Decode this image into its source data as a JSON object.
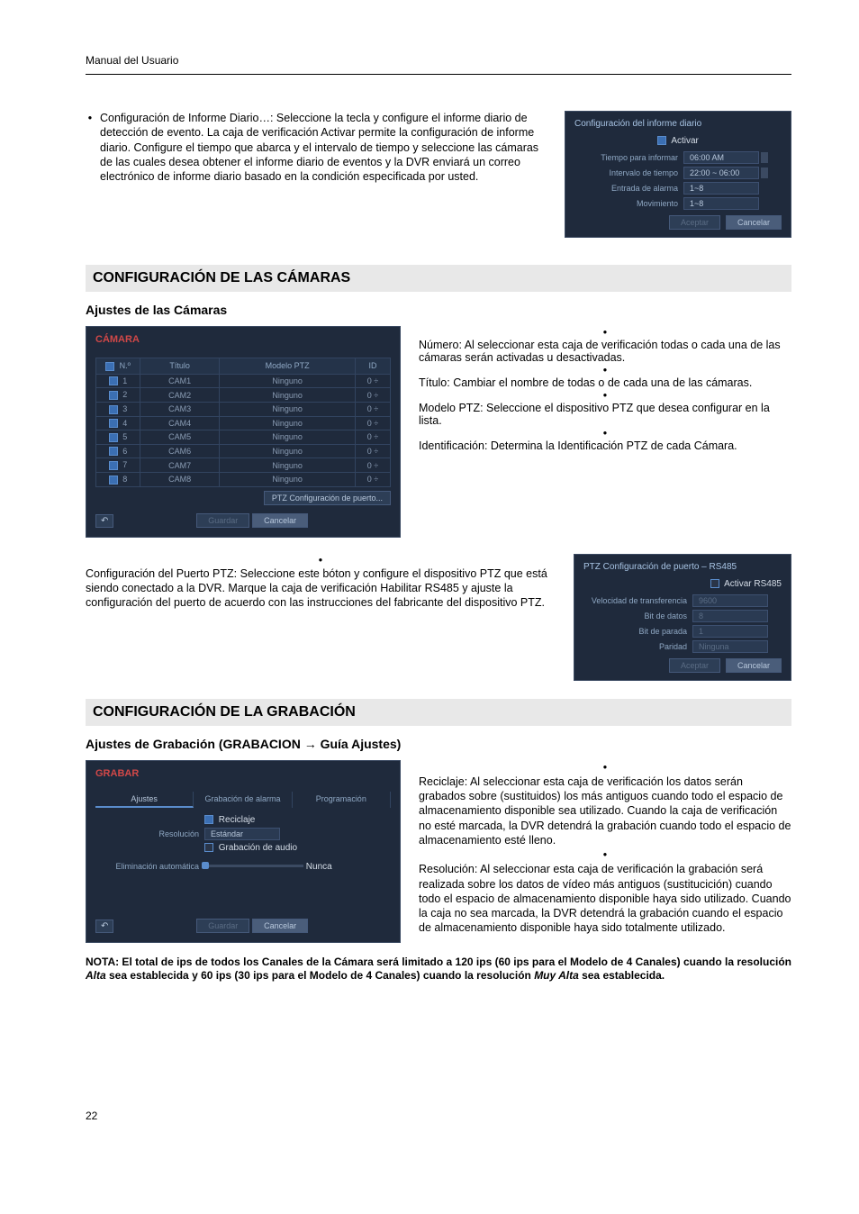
{
  "header": "Manual del Usuario",
  "page_number": "22",
  "intro_bullet": "Configuración de Informe Diario…: Seleccione la tecla y configure el informe diario de detección de evento. La caja de verificación Activar permite la configuración de informe diario. Configure el tiempo que abarca y el intervalo de tiempo y seleccione las cámaras de las cuales desea obtener el informe diario de eventos y la DVR enviará un correo electrónico de informe diario basado en la condición especificada por usted.",
  "daily_panel": {
    "title": "Configuración del informe diario",
    "activate": "Activar",
    "rows": {
      "time_to_report_k": "Tiempo para informar",
      "time_to_report_v": "06:00 AM",
      "interval_k": "Intervalo de tiempo",
      "interval_v": "22:00 ~ 06:00",
      "alarm_in_k": "Entrada de alarma",
      "alarm_in_v": "1~8",
      "motion_k": "Movimiento",
      "motion_v": "1~8"
    },
    "accept": "Aceptar",
    "cancel": "Cancelar"
  },
  "sec1_heading": "CONFIGURACIÓN DE LAS CÁMARAS",
  "sec1_sub": "Ajustes de las Cámaras",
  "camera_panel": {
    "title": "CÁMARA",
    "cols": {
      "no": "N.º",
      "title": "Título",
      "ptz": "Modelo PTZ",
      "id": "ID"
    },
    "rows": [
      {
        "n": "1",
        "t": "CAM1",
        "p": "Ninguno",
        "i": "0"
      },
      {
        "n": "2",
        "t": "CAM2",
        "p": "Ninguno",
        "i": "0"
      },
      {
        "n": "3",
        "t": "CAM3",
        "p": "Ninguno",
        "i": "0"
      },
      {
        "n": "4",
        "t": "CAM4",
        "p": "Ninguno",
        "i": "0"
      },
      {
        "n": "5",
        "t": "CAM5",
        "p": "Ninguno",
        "i": "0"
      },
      {
        "n": "6",
        "t": "CAM6",
        "p": "Ninguno",
        "i": "0"
      },
      {
        "n": "7",
        "t": "CAM7",
        "p": "Ninguno",
        "i": "0"
      },
      {
        "n": "8",
        "t": "CAM8",
        "p": "Ninguno",
        "i": "0"
      }
    ],
    "ptz_port_btn": "PTZ Configuración de puerto...",
    "save": "Guardar",
    "cancel": "Cancelar"
  },
  "camera_bullets": [
    "Número: Al seleccionar esta caja de verificación todas o cada una de las cámaras serán activadas u desactivadas.",
    "Título: Cambiar el nombre de todas o de cada una de las cámaras.",
    "Modelo PTZ: Seleccione el dispositivo PTZ que desea configurar en la lista.",
    "Identificación: Determina la Identificación PTZ de cada Cámara."
  ],
  "ptz_text": "Configuración del Puerto PTZ: Seleccione este bóton y configure el dispositivo PTZ que está siendo conectado a la DVR. Marque la caja de verificación Habilitar RS485 y ajuste la configuración del puerto de acuerdo con las instrucciones del fabricante del dispositivo PTZ.",
  "ptz_panel": {
    "title": "PTZ Configuración de puerto – RS485",
    "enable": "Activar RS485",
    "baud_k": "Velocidad de transferencia",
    "baud_v": "9600",
    "data_k": "Bit de datos",
    "data_v": "8",
    "stop_k": "Bit de parada",
    "stop_v": "1",
    "parity_k": "Paridad",
    "parity_v": "Ninguna",
    "accept": "Aceptar",
    "cancel": "Cancelar"
  },
  "sec2_heading": "CONFIGURACIÓN DE LA GRABACIÓN",
  "sec2_sub": "Ajustes de Grabación (GRABACION → Guía Ajustes)",
  "rec_panel": {
    "title": "GRABAR",
    "tab1": "Ajustes",
    "tab2": "Grabación de alarma",
    "tab3": "Programación",
    "reciclaje": "Reciclaje",
    "res_k": "Resolución",
    "res_v": "Estándar",
    "audio": "Grabación de audio",
    "autodel_k": "Eliminación automática",
    "autodel_v": "Nunca",
    "save": "Guardar",
    "cancel": "Cancelar"
  },
  "rec_bullets": [
    "Reciclaje: Al seleccionar esta caja de verificación los datos serán grabados sobre (sustituidos) los más antiguos cuando todo el espacio de almacenamiento disponible sea utilizado. Cuando la caja de verificación no esté marcada, la DVR detendrá la grabación cuando todo el espacio de almacenamiento esté lleno.",
    "Resolución: Al seleccionar esta caja de verificación la grabación será realizada sobre los datos de vídeo más antiguos (sustitucición) cuando todo el espacio de almacenamiento disponible haya sido utilizado. Cuando la caja no sea marcada, la DVR detendrá la grabación cuando el espacio de almacenamiento disponible haya sido totalmente utilizado."
  ],
  "note_parts": {
    "p1": "NOTA: El total de ips de todos los Canales de la Cámara será limitado a 120 ips (60 ips para el Modelo de 4 Canales) cuando la resolución ",
    "i1": "Alta",
    "p2": " sea establecida y 60 ips (30 ips para el Modelo de 4 Canales) cuando la resolución ",
    "i2": "Muy Alta",
    "p3": " sea establecida."
  }
}
